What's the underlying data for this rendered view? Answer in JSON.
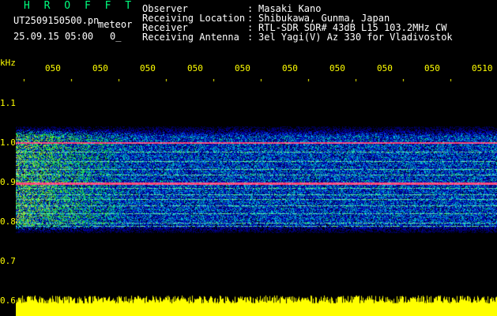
{
  "header": {
    "app_title": "H R O F F T",
    "file_name": "UT2509150500.pn",
    "file_tag": "meteor",
    "file_time": "25.09.15 05:00",
    "file_time_extra": "0_"
  },
  "station_info": [
    {
      "label": "Observer",
      "value": "Masaki Kano"
    },
    {
      "label": "Receiving Location",
      "value": "Shibukawa, Gunma, Japan"
    },
    {
      "label": "Receiver",
      "value": "RTL-SDR SDR# 43dB L15 103.2MHz CW"
    },
    {
      "label": "Receiving Antenna",
      "value": "3el Yagi(V) Az 330 for Vladivostok"
    }
  ],
  "axis": {
    "y_unit": "kHz",
    "x_ticks": [
      "050",
      "050",
      "050",
      "050",
      "050",
      "050",
      "050",
      "050",
      "050",
      "0510"
    ],
    "y_ticks": [
      "1.1",
      "1.0",
      "0.9",
      "0.8",
      "0.7",
      "0.6"
    ]
  },
  "colors": {
    "background": "#000000",
    "axis_text": "#ffff00",
    "title": "#00ff7f",
    "noise_base": "#00007f",
    "carrier_line": "#ff3366",
    "level_bar": "#ffff00"
  }
}
